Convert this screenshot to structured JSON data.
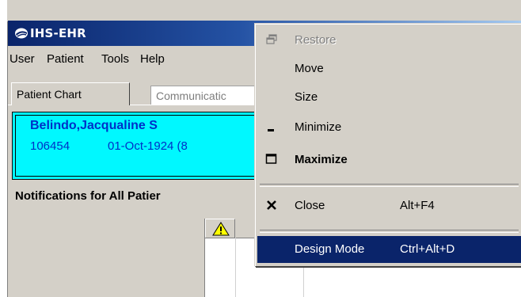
{
  "window": {
    "title": "IHS-EHR"
  },
  "menubar": {
    "items": [
      "User",
      "Patient",
      "Tools",
      "Help"
    ]
  },
  "tabs": [
    {
      "label": "Patient Chart",
      "active": true
    },
    {
      "label": "Communicatic",
      "active": false
    }
  ],
  "patient": {
    "name": "Belindo,Jacqualine S",
    "id": "106454",
    "dob": "01-Oct-1924 (8"
  },
  "notifications": {
    "title": "Notifications for All Patier"
  },
  "context_menu": {
    "items": [
      {
        "label": "Restore",
        "icon": "restore-icon",
        "disabled": true
      },
      {
        "label": "Move"
      },
      {
        "label": "Size"
      },
      {
        "label": "Minimize",
        "icon": "minimize-icon"
      },
      {
        "label": "Maximize",
        "icon": "maximize-icon",
        "bold": true
      },
      {
        "label": "Close",
        "icon": "close-icon",
        "shortcut": "Alt+F4"
      },
      {
        "label": "Design Mode",
        "shortcut": "Ctrl+Alt+D",
        "highlighted": true
      }
    ]
  },
  "colors": {
    "titlebar": "#0a246a",
    "banner": "#00f8ff",
    "patient_text": "#0030c8",
    "highlight": "#0a246a"
  }
}
